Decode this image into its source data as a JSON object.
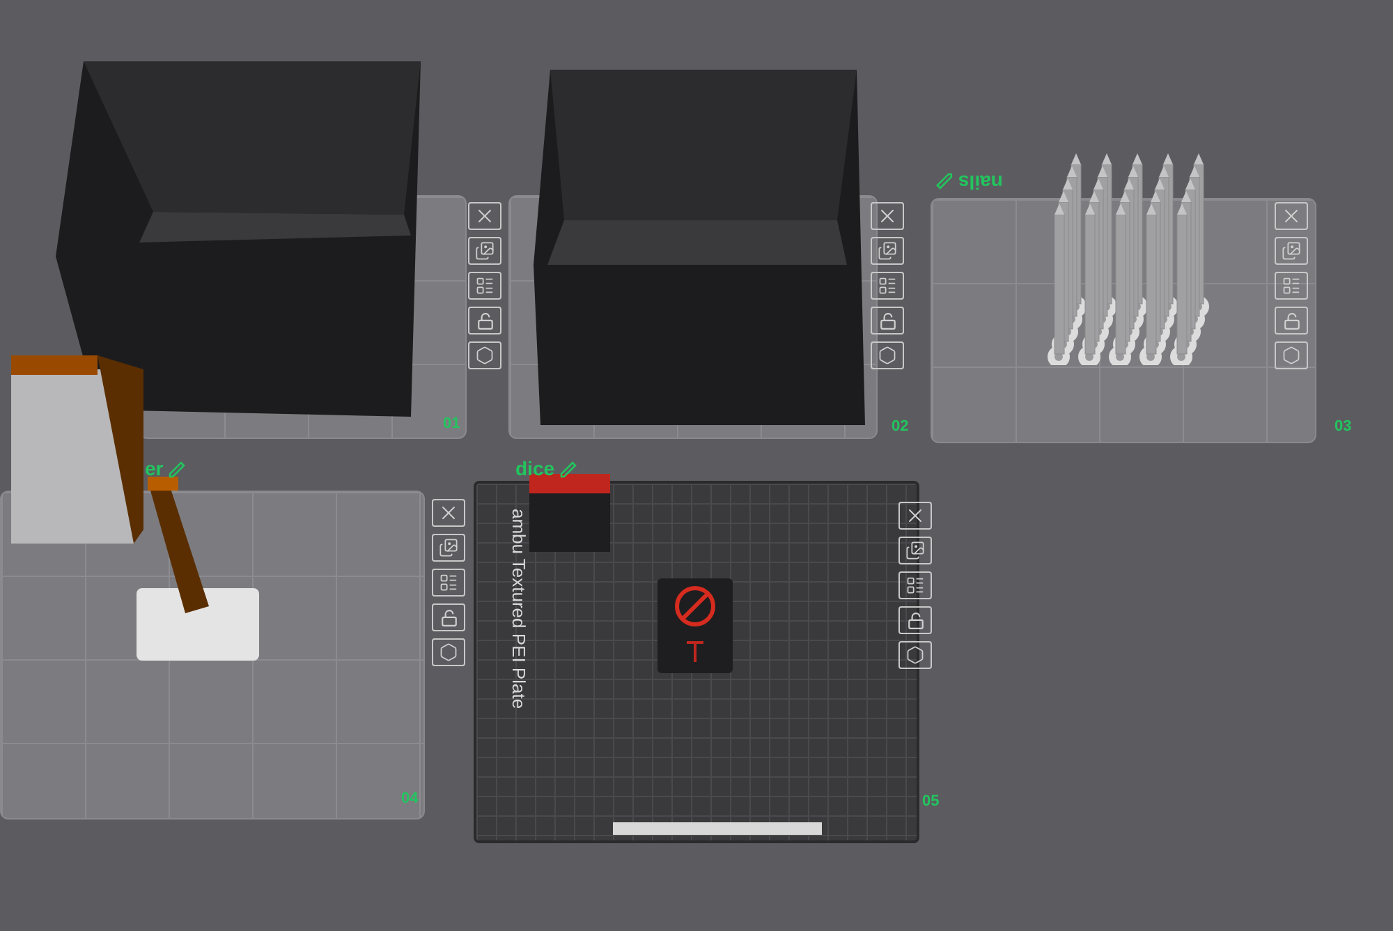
{
  "plates": [
    {
      "label": "01",
      "kind": "plain",
      "locked": false
    },
    {
      "label": "02",
      "kind": "plain",
      "locked": false
    },
    {
      "label": "03",
      "kind": "plain",
      "name": "nails",
      "name_flipped": true,
      "locked": false
    },
    {
      "label": "04",
      "kind": "plain",
      "name": "er",
      "name_flipped": false,
      "locked": false
    },
    {
      "label": "05",
      "kind": "textured",
      "name": "dice",
      "name_flipped": false,
      "locked": false,
      "plate_type": "ambu Textured PEI Plate"
    }
  ]
}
